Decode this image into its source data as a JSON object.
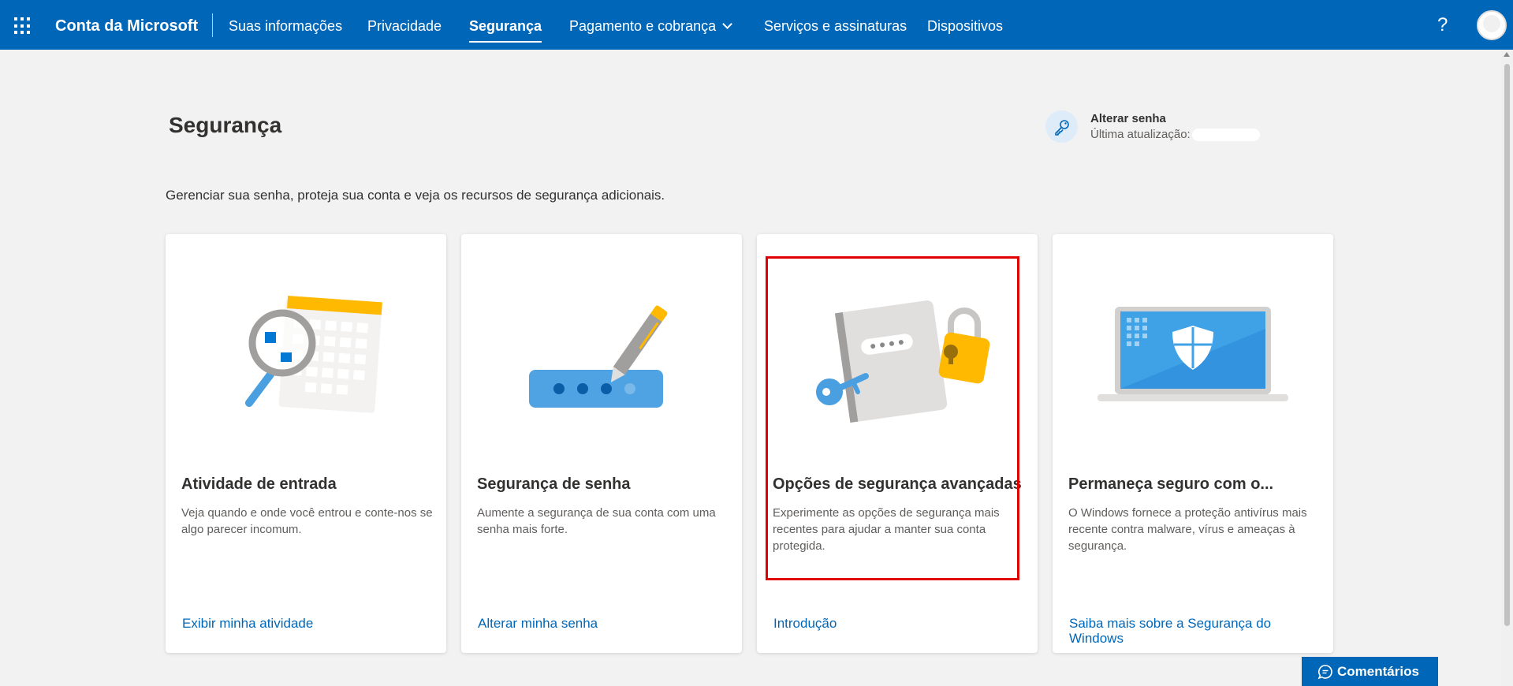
{
  "header": {
    "brand": "Conta da Microsoft",
    "nav": [
      {
        "label": "Suas informações"
      },
      {
        "label": "Privacidade"
      },
      {
        "label": "Segurança"
      },
      {
        "label": "Pagamento e cobrança"
      },
      {
        "label": "Serviços e assinaturas"
      },
      {
        "label": "Dispositivos"
      }
    ],
    "active_nav": "Segurança",
    "help_label": "?"
  },
  "page": {
    "title": "Segurança",
    "description": "Gerenciar sua senha, proteja sua conta e veja os recursos de segurança adicionais."
  },
  "password": {
    "title": "Alterar senha",
    "last_updated_label": "Última atualização:"
  },
  "cards": [
    {
      "title": "Atividade de entrada",
      "description": "Veja quando e onde você entrou e conte-nos se algo parecer incomum.",
      "link": "Exibir minha atividade",
      "icon": "magnifier-calendar-illustration"
    },
    {
      "title": "Segurança de senha",
      "description": "Aumente a segurança de sua conta com uma senha mais forte.",
      "link": "Alterar minha senha",
      "icon": "password-pen-illustration"
    },
    {
      "title": "Opções de segurança avançadas",
      "description": "Experimente as opções de segurança mais recentes para ajudar a manter sua conta protegida.",
      "link": "Introdução",
      "icon": "notebook-lock-key-illustration"
    },
    {
      "title": "Permaneça seguro com o...",
      "description": "O Windows fornece a proteção antivírus mais recente contra malware, vírus e ameaças à segurança.",
      "link": "Saiba mais sobre a Segurança do Windows",
      "icon": "laptop-shield-illustration"
    }
  ],
  "feedback": {
    "label": "Comentários"
  },
  "colors": {
    "brand_blue": "#0067b8",
    "highlight_red": "#e00000",
    "page_bg": "#f2f2f2"
  }
}
